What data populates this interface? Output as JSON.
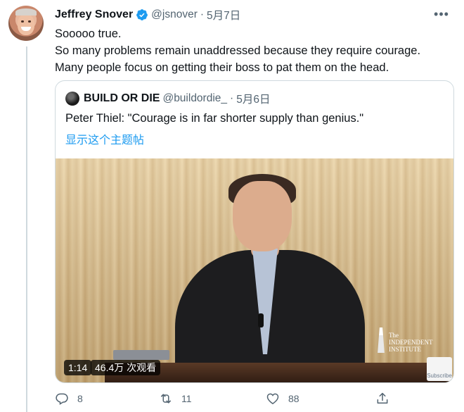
{
  "tweet": {
    "author_name": "Jeffrey Snover",
    "handle": "@jsnover",
    "separator": "·",
    "date": "5月7日",
    "more_icon": "more-dots-icon",
    "lines": [
      "Sooooo true.",
      "So many problems remain unaddressed because they require courage.",
      "Many people focus on getting their boss to pat them on the head."
    ]
  },
  "quote": {
    "author_name": "BUILD OR DIE",
    "handle": "@buildordie_",
    "separator": "·",
    "date": "5月6日",
    "text": "Peter Thiel: \"Courage is in far shorter supply than genius.\"",
    "show_thread": "显示这个主题帖",
    "video": {
      "duration": "1:14",
      "views": "46.4万 次观看",
      "logo_line1": "The INDEPENDENT",
      "logo_line2": "INSTITUTE",
      "subscribe_label": "Subscribe"
    }
  },
  "actions": {
    "reply_count": "8",
    "retweet_count": "11",
    "like_count": "88"
  },
  "colors": {
    "accent": "#1d9bf0",
    "secondary_text": "#536471",
    "border": "#cfd9de"
  }
}
